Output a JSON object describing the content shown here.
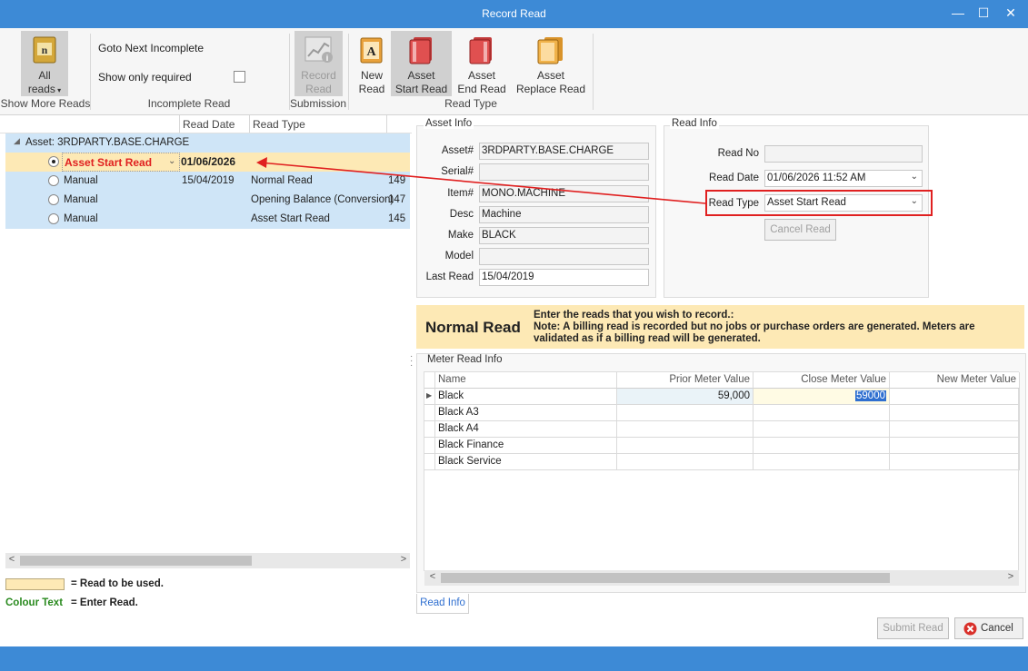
{
  "window": {
    "title": "Record Read",
    "minimize": "—",
    "maximize": "☐",
    "close": "✕"
  },
  "ribbon": {
    "all_reads": {
      "line1": "All",
      "line2": "reads"
    },
    "goto_next_incomplete": "Goto Next Incomplete",
    "show_only_required": "Show only required",
    "record_read": {
      "line1": "Record",
      "line2": "Read"
    },
    "new_read": {
      "line1": "New",
      "line2": "Read"
    },
    "asset_start_read": {
      "line1": "Asset",
      "line2": "Start Read"
    },
    "asset_end_read": {
      "line1": "Asset",
      "line2": "End Read"
    },
    "asset_replace_read": {
      "line1": "Asset",
      "line2": "Replace Read"
    },
    "groups": {
      "show_more_reads": "Show More Reads",
      "incomplete_read": "Incomplete Read",
      "submission": "Submission",
      "read_type": "Read Type"
    }
  },
  "left": {
    "columns": {
      "read_date": "Read Date",
      "read_type": "Read Type"
    },
    "tree_root": "Asset: 3RDPARTY.BASE.CHARGE",
    "selected_row": {
      "type": "Asset Start Read",
      "date": "01/06/2026"
    },
    "rows": [
      {
        "source": "Manual",
        "date": "15/04/2019",
        "type": "Normal Read",
        "id": "149"
      },
      {
        "source": "Manual",
        "date": "",
        "type": "Opening Balance (Conversion)",
        "id": "147"
      },
      {
        "source": "Manual",
        "date": "",
        "type": "Asset Start Read",
        "id": "145"
      }
    ],
    "legend": {
      "read_to_be_used": "= Read to be used.",
      "colour_text": "Colour Text",
      "enter_read": "= Enter Read."
    }
  },
  "asset_info": {
    "title": "Asset Info",
    "labels": {
      "asset": "Asset#",
      "serial": "Serial#",
      "item": "Item#",
      "desc": "Desc",
      "make": "Make",
      "model": "Model",
      "last_read": "Last Read"
    },
    "values": {
      "asset": "3RDPARTY.BASE.CHARGE",
      "serial": "",
      "item": "MONO.MACHINE",
      "desc": "Machine",
      "make": "BLACK",
      "model": "",
      "last_read": "15/04/2019"
    }
  },
  "read_info": {
    "title": "Read Info",
    "labels": {
      "read_no": "Read No",
      "read_date": "Read Date",
      "read_type": "Read Type"
    },
    "values": {
      "read_no": "",
      "read_date": "01/06/2026 11:52 AM",
      "read_type": "Asset Start Read"
    },
    "cancel_read": "Cancel Read"
  },
  "banner": {
    "title": "Normal Read",
    "line1": "Enter the reads that you wish to record.:",
    "line2": "Note: A billing read is recorded but no jobs or purchase orders are generated. Meters are validated as if a billing read will be generated."
  },
  "meter_read": {
    "title": "Meter Read Info",
    "columns": [
      "Name",
      "Prior Meter Value",
      "Close Meter Value",
      "New Meter Value"
    ],
    "rows": [
      {
        "name": "Black",
        "prior": "59,000",
        "close": "59000",
        "new": ""
      },
      {
        "name": "Black A3",
        "prior": "",
        "close": "",
        "new": ""
      },
      {
        "name": "Black A4",
        "prior": "",
        "close": "",
        "new": ""
      },
      {
        "name": "Black Finance",
        "prior": "",
        "close": "",
        "new": ""
      },
      {
        "name": "Black Service",
        "prior": "",
        "close": "",
        "new": ""
      }
    ],
    "tab": "Read Info"
  },
  "footer": {
    "submit_read": "Submit Read",
    "cancel": "Cancel"
  },
  "colors": {
    "titlebar": "#3d8ad6",
    "selected_row": "#fde9b5",
    "row_highlight": "#cfe5f7",
    "accent_red": "#e02020",
    "legend_green": "#2a8a1f"
  }
}
